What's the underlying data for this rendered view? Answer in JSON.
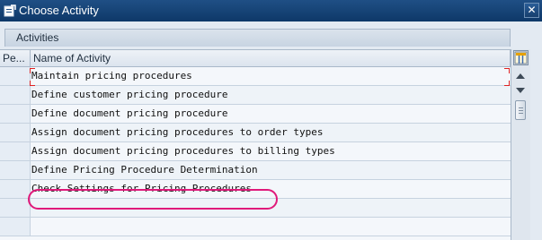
{
  "window": {
    "title": "Choose Activity",
    "close_glyph": "✕"
  },
  "section": {
    "title": "Activities"
  },
  "table": {
    "columns": [
      "Pe...",
      "Name of Activity"
    ],
    "rows": [
      {
        "name": "Maintain pricing procedures",
        "focused": true
      },
      {
        "name": "Define customer pricing procedure"
      },
      {
        "name": "Define document pricing procedure"
      },
      {
        "name": "Assign document pricing procedures to order types"
      },
      {
        "name": "Assign document pricing procedures to billing types"
      },
      {
        "name": "Define Pricing Procedure Determination",
        "highlighted": true
      },
      {
        "name": "Check Settings for Pricing Procedures"
      },
      {
        "name": ""
      },
      {
        "name": ""
      }
    ]
  },
  "colors": {
    "titlebar": "#0e3868",
    "highlight_ring": "#e0197a",
    "focus_bracket": "#dd2222"
  },
  "icons": {
    "window": "choose-activity-window-icon",
    "close": "close-icon",
    "column_select": "column-settings-icon",
    "scroll_up": "scroll-up-arrow-icon",
    "scroll_down": "scroll-down-arrow-icon"
  }
}
